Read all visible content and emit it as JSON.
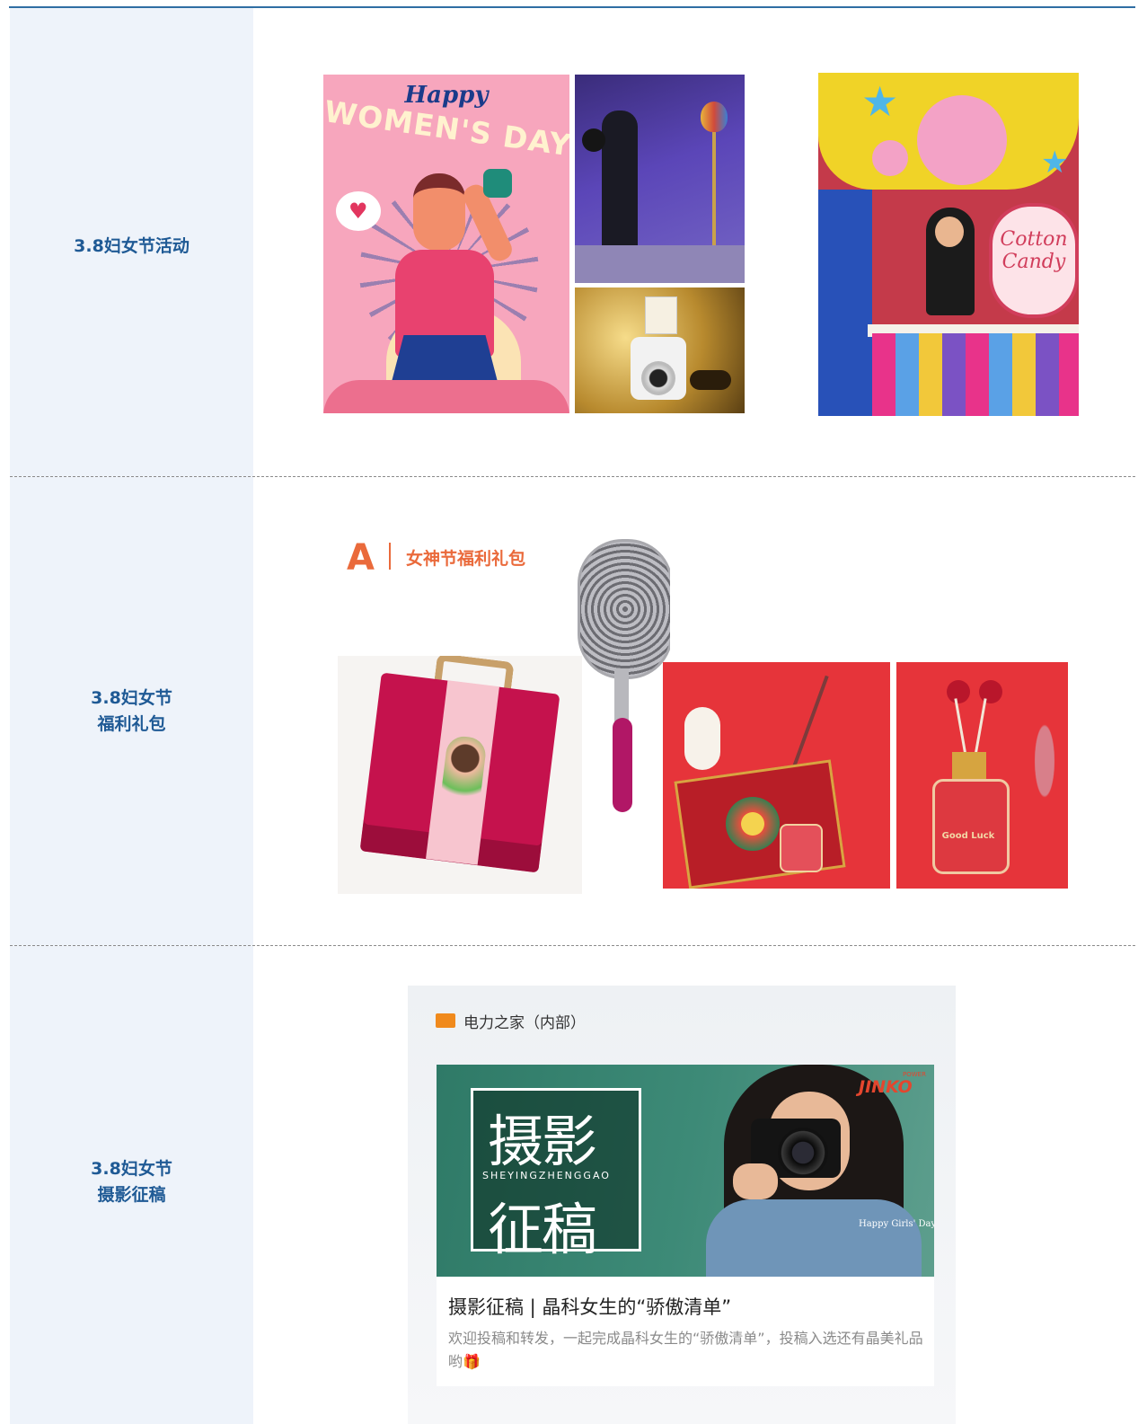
{
  "rows": [
    {
      "label_line1": "3.8妇女节活动",
      "label_line2": ""
    },
    {
      "label_line1": "3.8妇女节",
      "label_line2": "福利礼包"
    },
    {
      "label_line1": "3.8妇女节",
      "label_line2": "摄影征稿"
    }
  ],
  "row1": {
    "poster_happy": "Happy",
    "poster_title": "WOMEN'S DAY",
    "candy_sign": "Cotton Candy"
  },
  "row2": {
    "header_letter": "A",
    "header_title": "女神节福利礼包",
    "bottle_text": "Good Luck"
  },
  "row3": {
    "app_name": "电力之家（内部）",
    "hero_big1": "摄影",
    "hero_pinyin": "SHEYINGZHENGGAO",
    "hero_big2": "征稿",
    "brand": "JINKO",
    "brand_top": "POWER",
    "hero_caption": "Happy Girls' Day",
    "article_title": "摄影征稿 | 晶科女生的“骄傲清单”",
    "article_desc": "欢迎投稿和转发，一起完成晶科女生的“骄傲清单”，投稿入选还有晶美礼品哟",
    "gift_icon": "🎁"
  }
}
